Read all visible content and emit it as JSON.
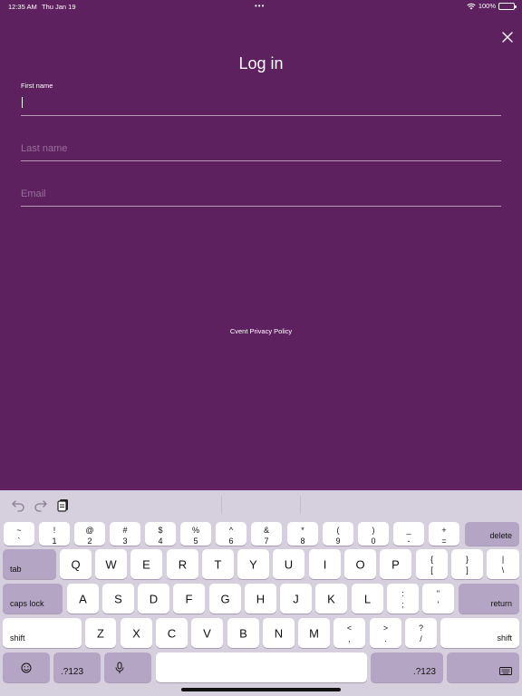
{
  "status_bar": {
    "time": "12:35 AM",
    "date": "Thu Jan 19",
    "dots": "•••",
    "battery": "100%",
    "battery_level": 1.0,
    "wifi_icon": "wifi-icon",
    "battery_icon": "battery-icon"
  },
  "header": {
    "title": "Log in",
    "close_icon": "close-icon"
  },
  "form": {
    "first_name_label": "First name",
    "first_name_value": "",
    "last_name_placeholder": "Last name",
    "email_placeholder": "Email"
  },
  "footer": {
    "privacy_link": "Cvent Privacy Policy"
  },
  "keyboard": {
    "toolbar": {
      "undo_icon": "undo-icon",
      "redo_icon": "redo-icon",
      "paste_icon": "paste-icon"
    },
    "number_row": [
      {
        "top": "~",
        "bot": "`"
      },
      {
        "top": "!",
        "bot": "1"
      },
      {
        "top": "@",
        "bot": "2"
      },
      {
        "top": "#",
        "bot": "3"
      },
      {
        "top": "$",
        "bot": "4"
      },
      {
        "top": "%",
        "bot": "5"
      },
      {
        "top": "^",
        "bot": "6"
      },
      {
        "top": "&",
        "bot": "7"
      },
      {
        "top": "*",
        "bot": "8"
      },
      {
        "top": "(",
        "bot": "9"
      },
      {
        "top": ")",
        "bot": "0"
      },
      {
        "top": "_",
        "bot": "-"
      },
      {
        "top": "+",
        "bot": "="
      }
    ],
    "delete": "delete",
    "tab": "tab",
    "row_q": [
      "Q",
      "W",
      "E",
      "R",
      "T",
      "Y",
      "U",
      "I",
      "O",
      "P"
    ],
    "row_q_extra": [
      {
        "top": "{",
        "bot": "["
      },
      {
        "top": "}",
        "bot": "]"
      },
      {
        "top": "|",
        "bot": "\\"
      }
    ],
    "caps_lock": "caps lock",
    "row_a": [
      "A",
      "S",
      "D",
      "F",
      "G",
      "H",
      "J",
      "K",
      "L"
    ],
    "row_a_extra": [
      {
        "top": ":",
        "bot": ";"
      },
      {
        "top": "\"",
        "bot": "'"
      }
    ],
    "return": "return",
    "shift": "shift",
    "row_z": [
      "Z",
      "X",
      "C",
      "V",
      "B",
      "N",
      "M"
    ],
    "row_z_extra": [
      {
        "top": "<",
        "bot": ","
      },
      {
        "top": ">",
        "bot": "."
      },
      {
        "top": "?",
        "bot": "/"
      }
    ],
    "shift_right": "shift",
    "numbers_left": ".?123",
    "numbers_right": ".?123",
    "emoji_icon": "emoji-icon",
    "mic_icon": "microphone-icon",
    "hide_keyboard_icon": "keyboard-hide-icon"
  }
}
